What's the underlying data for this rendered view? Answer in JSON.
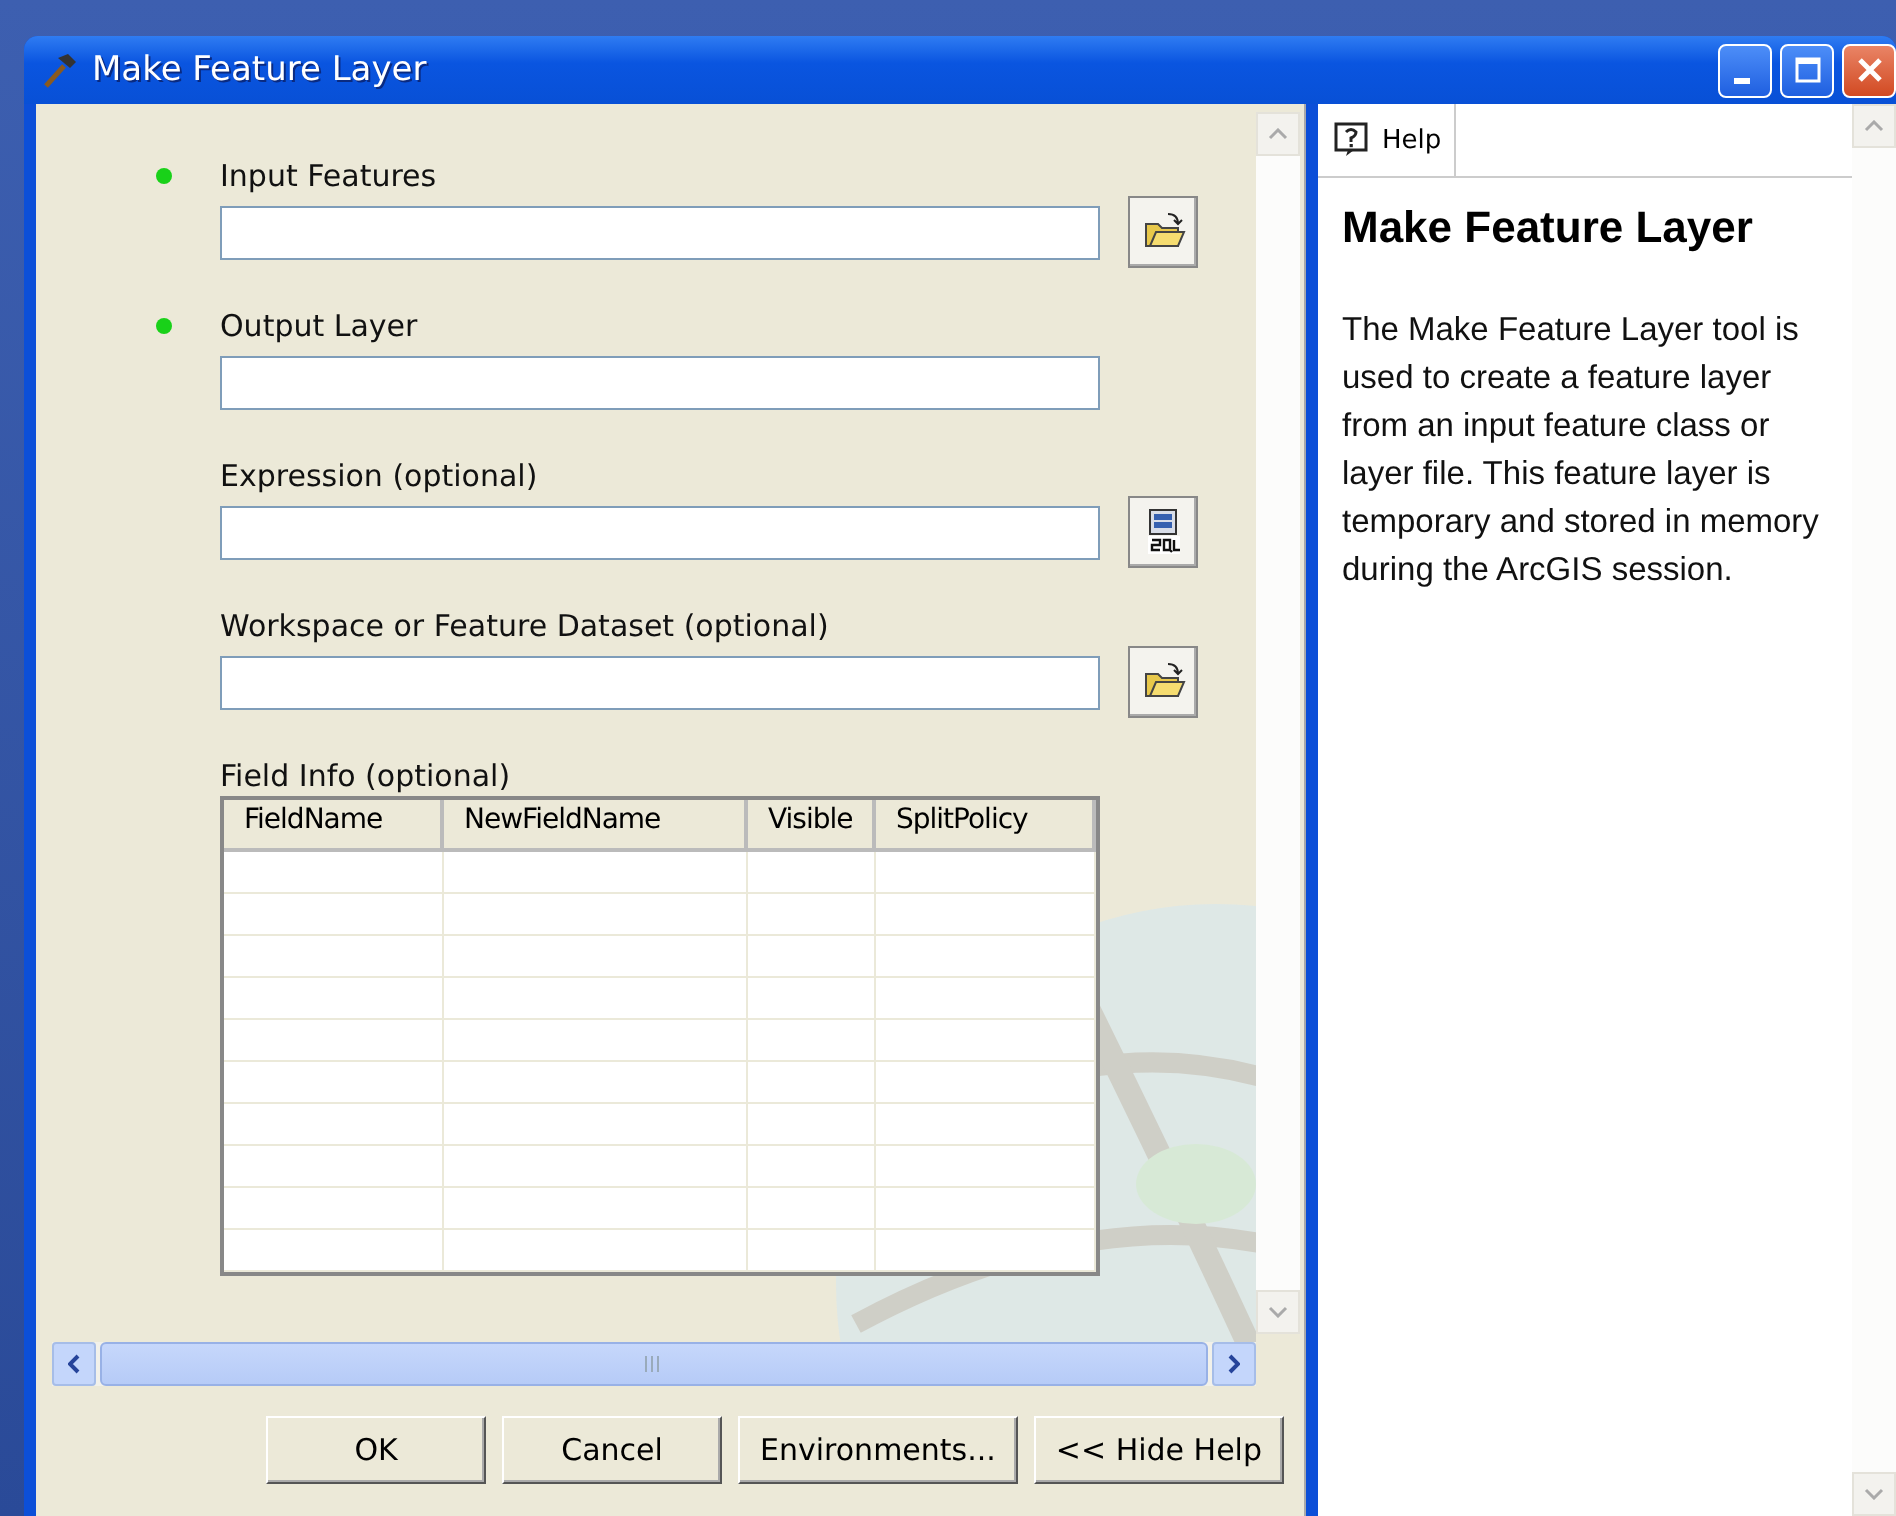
{
  "window": {
    "title": "Make Feature Layer"
  },
  "parameters": [
    {
      "label": "Input Features",
      "required": true,
      "kind": "path"
    },
    {
      "label": "Output Layer",
      "required": true,
      "kind": "text"
    },
    {
      "label": "Expression (optional)",
      "required": false,
      "kind": "sql"
    },
    {
      "label": "Workspace or Feature Dataset (optional)",
      "required": false,
      "kind": "path"
    },
    {
      "label": "Field Info (optional)",
      "required": false,
      "kind": "table",
      "columns": [
        "FieldName",
        "NewFieldName",
        "Visible",
        "SplitPolicy"
      ]
    }
  ],
  "buttons": [
    "OK",
    "Cancel",
    "Environments...",
    "<< Hide Help"
  ],
  "help": {
    "tab": "Help",
    "title": "Make Feature Layer",
    "body": "The Make Feature Layer tool is used to create a feature layer from an input feature class or layer file. This feature layer is temporary and stored in memory during the ArcGIS session."
  }
}
